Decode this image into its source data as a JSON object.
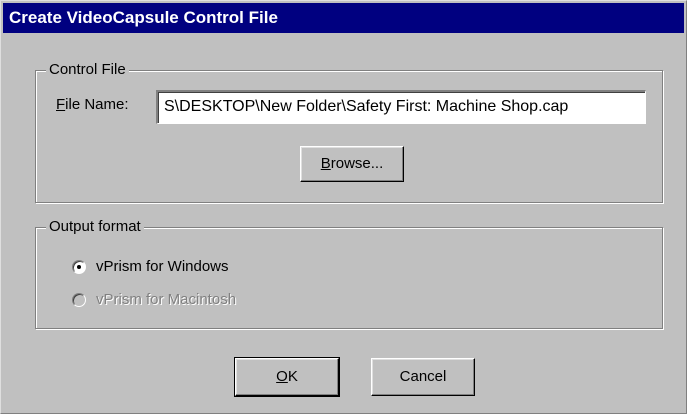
{
  "window": {
    "title": "Create VideoCapsule Control File"
  },
  "control_file": {
    "legend": "Control File",
    "file_name_label_mnemonic": "F",
    "file_name_label_rest": "ile Name:",
    "file_name_value": "S\\DESKTOP\\New Folder\\Safety First: Machine Shop.cap",
    "browse_mnemonic": "B",
    "browse_rest": "rowse..."
  },
  "output_format": {
    "legend": "Output format",
    "options": [
      {
        "label": "vPrism for Windows",
        "selected": true,
        "enabled": true
      },
      {
        "label": "vPrism for Macintosh",
        "selected": false,
        "enabled": false
      }
    ]
  },
  "buttons": {
    "ok_mnemonic": "O",
    "ok_rest": "K",
    "cancel": "Cancel"
  }
}
